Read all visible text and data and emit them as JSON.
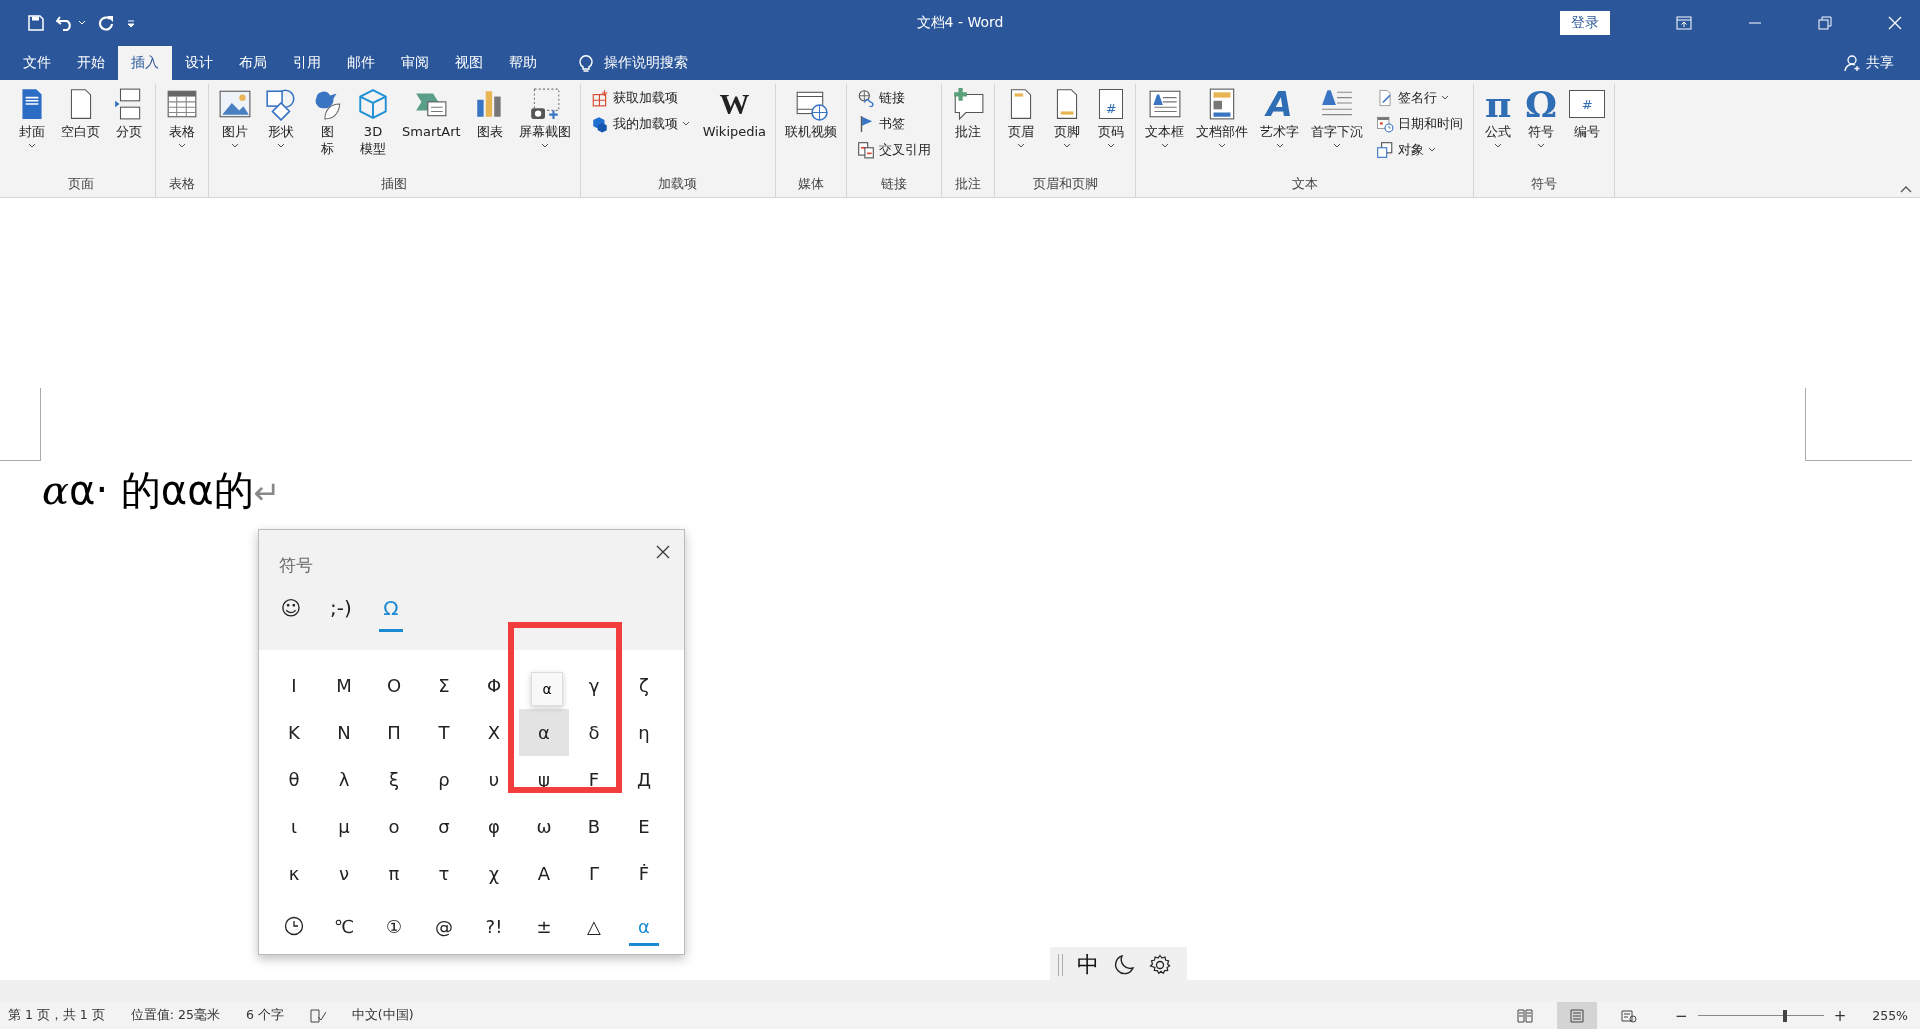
{
  "window": {
    "title": "文档4 - Word",
    "sign_in": "登录"
  },
  "menu_tabs": [
    {
      "label": "文件",
      "selected": false
    },
    {
      "label": "开始",
      "selected": false
    },
    {
      "label": "插入",
      "selected": true
    },
    {
      "label": "设计",
      "selected": false
    },
    {
      "label": "布局",
      "selected": false
    },
    {
      "label": "引用",
      "selected": false
    },
    {
      "label": "邮件",
      "selected": false
    },
    {
      "label": "审阅",
      "selected": false
    },
    {
      "label": "视图",
      "selected": false
    },
    {
      "label": "帮助",
      "selected": false
    }
  ],
  "tell_me": "操作说明搜索",
  "share": "共享",
  "ribbon_groups": [
    {
      "label": "页面",
      "items": [
        {
          "label": "封面",
          "kind": "large",
          "dropdown": true
        },
        {
          "label": "空白页",
          "kind": "large",
          "dropdown": false
        },
        {
          "label": "分页",
          "kind": "large",
          "dropdown": false
        }
      ]
    },
    {
      "label": "表格",
      "items": [
        {
          "label": "表格",
          "kind": "large",
          "dropdown": true
        }
      ]
    },
    {
      "label": "插图",
      "items": [
        {
          "label": "图片",
          "kind": "large",
          "dropdown": true
        },
        {
          "label": "形状",
          "kind": "large",
          "dropdown": true
        },
        {
          "label": "图标",
          "kind": "large",
          "dropdown": false,
          "stacked": true
        },
        {
          "label": "3D\n模型",
          "kind": "large",
          "dropdown": false
        },
        {
          "label": "SmartArt",
          "kind": "large",
          "dropdown": false
        },
        {
          "label": "图表",
          "kind": "large",
          "dropdown": false
        },
        {
          "label": "屏幕截图",
          "kind": "large",
          "dropdown": true
        }
      ]
    },
    {
      "label": "加载项",
      "items": [
        {
          "label": "获取加载项",
          "kind": "small",
          "dropdown": false
        },
        {
          "label": "我的加载项",
          "kind": "small",
          "dropdown": true
        },
        {
          "label": "Wikipedia",
          "kind": "large",
          "dropdown": false,
          "glyph": "W"
        }
      ]
    },
    {
      "label": "媒体",
      "items": [
        {
          "label": "联机视频",
          "kind": "large",
          "dropdown": false
        }
      ]
    },
    {
      "label": "链接",
      "items": [
        {
          "label": "链接",
          "kind": "small",
          "dropdown": false
        },
        {
          "label": "书签",
          "kind": "small",
          "dropdown": false
        },
        {
          "label": "交叉引用",
          "kind": "small",
          "dropdown": false
        }
      ]
    },
    {
      "label": "批注",
      "items": [
        {
          "label": "批注",
          "kind": "large",
          "dropdown": false
        }
      ]
    },
    {
      "label": "页眉和页脚",
      "items": [
        {
          "label": "页眉",
          "kind": "large",
          "dropdown": true
        },
        {
          "label": "页脚",
          "kind": "large",
          "dropdown": true
        },
        {
          "label": "页码",
          "kind": "large",
          "dropdown": true,
          "glyph": "#"
        }
      ]
    },
    {
      "label": "文本",
      "items": [
        {
          "label": "文本框",
          "kind": "large",
          "dropdown": true
        },
        {
          "label": "文档部件",
          "kind": "large",
          "dropdown": true
        },
        {
          "label": "艺术字",
          "kind": "large",
          "dropdown": true,
          "glyph": "A"
        },
        {
          "label": "首字下沉",
          "kind": "large",
          "dropdown": true
        },
        {
          "label": "签名行",
          "kind": "small",
          "dropdown": true
        },
        {
          "label": "日期和时间",
          "kind": "small",
          "dropdown": false
        },
        {
          "label": "对象",
          "kind": "small",
          "dropdown": true
        }
      ]
    },
    {
      "label": "符号",
      "items": [
        {
          "label": "公式",
          "kind": "large",
          "dropdown": true,
          "glyph": "π"
        },
        {
          "label": "符号",
          "kind": "large",
          "dropdown": true,
          "glyph": "Ω"
        },
        {
          "label": "编号",
          "kind": "large",
          "dropdown": false,
          "glyph": "#"
        }
      ]
    }
  ],
  "document": {
    "segments": [
      {
        "kind": "math",
        "text": "α"
      },
      {
        "kind": "plain",
        "text": "α· 的αα的"
      }
    ],
    "paragraph_mark": "↵"
  },
  "symbol_panel": {
    "title": "符号",
    "categories": [
      {
        "label": "☺",
        "selected": false
      },
      {
        "label": ";-)",
        "selected": false
      },
      {
        "label": "Ω",
        "selected": true
      }
    ],
    "rows": [
      [
        {
          "char": "Ι",
          "selected": false
        },
        {
          "char": "Μ",
          "selected": false
        },
        {
          "char": "Ο",
          "selected": false
        },
        {
          "char": "Σ",
          "selected": false
        },
        {
          "char": "Φ",
          "selected": false
        },
        null,
        {
          "char": "γ",
          "selected": false
        },
        {
          "char": "ζ",
          "selected": false
        }
      ],
      [
        {
          "char": "Κ",
          "selected": false
        },
        {
          "char": "Ν",
          "selected": false
        },
        {
          "char": "Π",
          "selected": false
        },
        {
          "char": "Τ",
          "selected": false
        },
        {
          "char": "Χ",
          "selected": false
        },
        {
          "char": "α",
          "selected": true
        },
        {
          "char": "δ",
          "selected": false
        },
        {
          "char": "η",
          "selected": false
        }
      ],
      [
        {
          "char": "θ",
          "selected": false
        },
        {
          "char": "λ",
          "selected": false
        },
        {
          "char": "ξ",
          "selected": false
        },
        {
          "char": "ρ",
          "selected": false
        },
        {
          "char": "υ",
          "selected": false
        },
        {
          "char": "ψ",
          "selected": false
        },
        {
          "char": "Ϝ",
          "selected": false
        },
        {
          "char": "Д",
          "selected": false
        }
      ],
      [
        {
          "char": "ι",
          "selected": false
        },
        {
          "char": "μ",
          "selected": false
        },
        {
          "char": "ο",
          "selected": false
        },
        {
          "char": "σ",
          "selected": false
        },
        {
          "char": "φ",
          "selected": false
        },
        {
          "char": "ω",
          "selected": false
        },
        {
          "char": "Β",
          "selected": false
        },
        {
          "char": "Ε",
          "selected": false
        }
      ],
      [
        {
          "char": "κ",
          "selected": false
        },
        {
          "char": "ν",
          "selected": false
        },
        {
          "char": "π",
          "selected": false
        },
        {
          "char": "τ",
          "selected": false
        },
        {
          "char": "χ",
          "selected": false
        },
        {
          "char": "Α",
          "selected": false
        },
        {
          "char": "Γ",
          "selected": false
        },
        {
          "char": "Ḟ",
          "selected": false
        }
      ]
    ],
    "tooltip": "α",
    "bottom_tabs": [
      {
        "kind": "clock",
        "selected": false
      },
      {
        "kind": "text",
        "label": "℃",
        "selected": false
      },
      {
        "kind": "text",
        "label": "①",
        "selected": false
      },
      {
        "kind": "text",
        "label": "@",
        "selected": false
      },
      {
        "kind": "text",
        "label": "?!",
        "selected": false
      },
      {
        "kind": "text",
        "label": "±",
        "selected": false
      },
      {
        "kind": "text",
        "label": "△",
        "selected": false
      },
      {
        "kind": "text",
        "label": "α",
        "selected": true
      }
    ]
  },
  "ime_toolbar": {
    "mode": "中"
  },
  "status_bar": {
    "page": "第 1 页，共 1 页",
    "position": "位置值: 25毫米",
    "word_count": "6 个字",
    "language": "中文(中国)",
    "views": [
      {
        "selected": false
      },
      {
        "selected": true
      },
      {
        "selected": false
      }
    ],
    "zoom_out": "−",
    "zoom_in": "+",
    "zoom": {
      "level": 0.68
    },
    "zoom_text": "255%"
  }
}
